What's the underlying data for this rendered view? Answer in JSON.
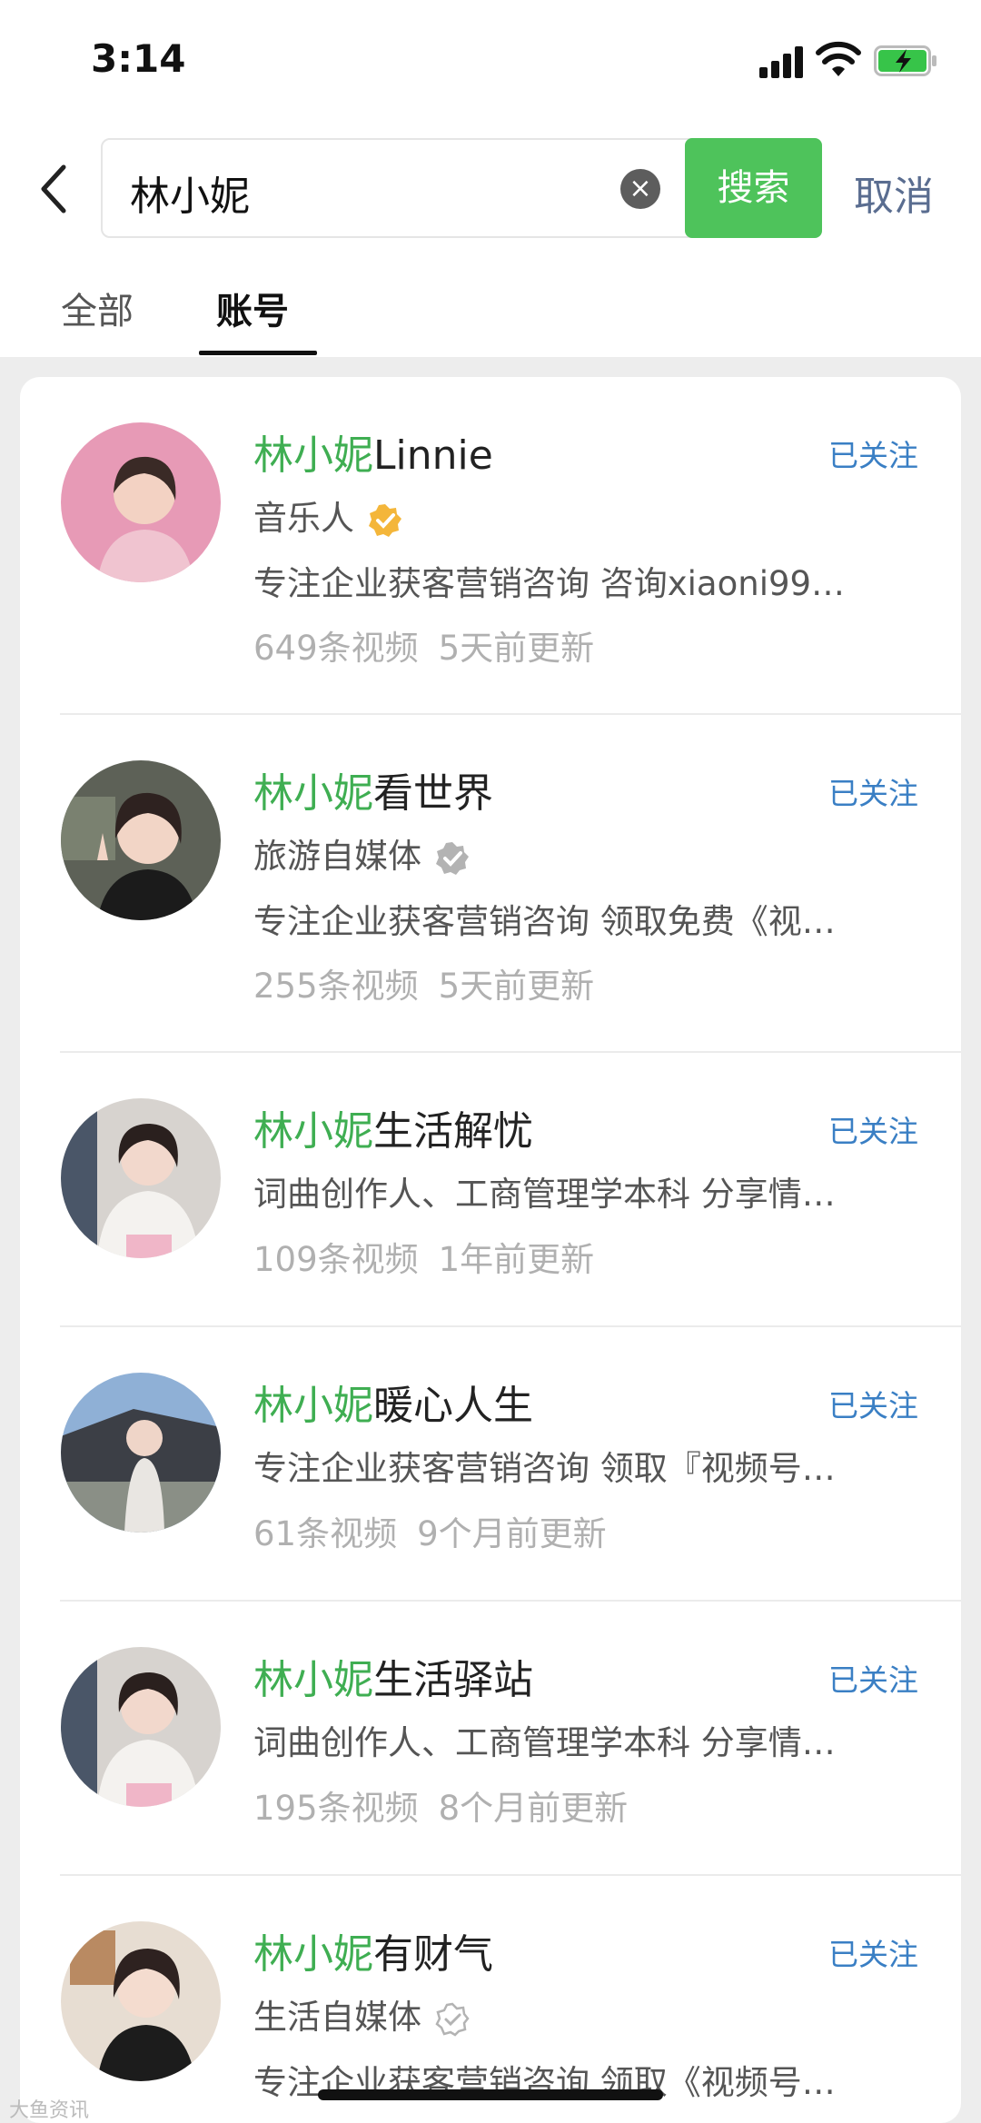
{
  "status_bar": {
    "time": "3:14"
  },
  "search": {
    "query": "林小妮",
    "search_button": "搜索",
    "cancel": "取消"
  },
  "tabs": [
    {
      "label": "全部"
    },
    {
      "label": "账号"
    }
  ],
  "results": [
    {
      "name_highlight": "林小妮",
      "name_rest": "Linnie",
      "follow": "已关注",
      "category": "音乐人",
      "verified": "gold",
      "desc": "专注企业获客营销咨询 咨询xiaoni99…",
      "videos": "649条视频",
      "updated": "5天前更新",
      "avatar_color": "#e79ab6"
    },
    {
      "name_highlight": "林小妮",
      "name_rest": "看世界",
      "follow": "已关注",
      "category": "旅游自媒体",
      "verified": "gray",
      "desc": "专注企业获客营销咨询 领取免费《视…",
      "videos": "255条视频",
      "updated": "5天前更新",
      "avatar_color": "#5d6157"
    },
    {
      "name_highlight": "林小妮",
      "name_rest": "生活解忧",
      "follow": "已关注",
      "category": "",
      "verified": "",
      "desc": "词曲创作人、工商管理学本科 分享情…",
      "videos": "109条视频",
      "updated": "1年前更新",
      "avatar_color": "#c9c2bd"
    },
    {
      "name_highlight": "林小妮",
      "name_rest": "暖心人生",
      "follow": "已关注",
      "category": "",
      "verified": "",
      "desc": "专注企业获客营销咨询 领取『视频号…",
      "videos": "61条视频",
      "updated": "9个月前更新",
      "avatar_color": "#7f9bbd"
    },
    {
      "name_highlight": "林小妮",
      "name_rest": "生活驿站",
      "follow": "已关注",
      "category": "",
      "verified": "",
      "desc": "词曲创作人、工商管理学本科 分享情…",
      "videos": "195条视频",
      "updated": "8个月前更新",
      "avatar_color": "#c9c2bd"
    },
    {
      "name_highlight": "林小妮",
      "name_rest": "有财气",
      "follow": "已关注",
      "category": "生活自媒体",
      "verified": "outline",
      "desc": "专注企业获客营销咨询 领取《视频号…",
      "videos": "",
      "updated": "",
      "avatar_color": "#b98a62"
    }
  ],
  "watermark": "大鱼资讯"
}
